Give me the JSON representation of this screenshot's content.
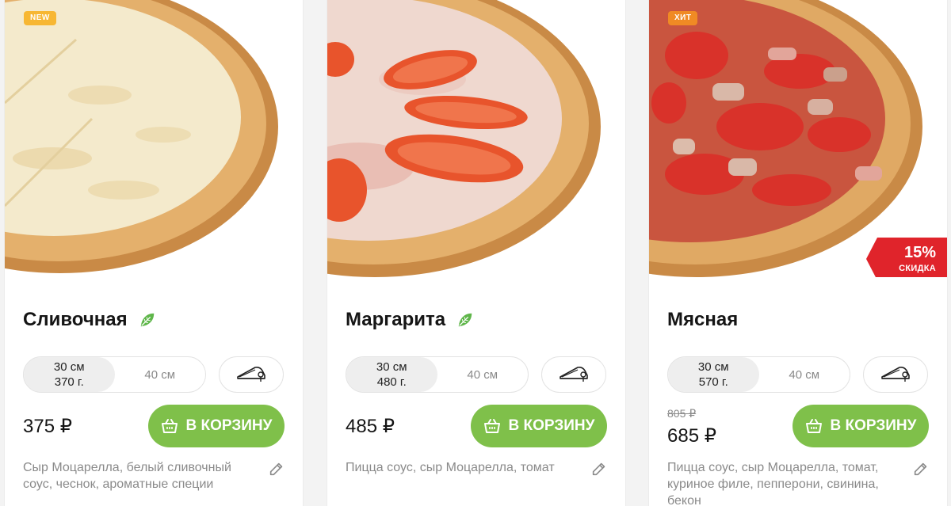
{
  "colors": {
    "accent_green": "#7fc04a",
    "discount_red": "#e0242b",
    "badge_new": "#f7b733",
    "badge_hit": "#f08a24",
    "text_dark": "#151515",
    "text_muted": "#8a8a8a"
  },
  "products": [
    {
      "badge": "NEW",
      "name": "Сливочная",
      "vegetarian_icon": "leaf-icon",
      "sizes": [
        {
          "size": "30 см",
          "weight": "370 г.",
          "selected": true
        },
        {
          "size": "40 см",
          "weight": "",
          "selected": false
        }
      ],
      "crust_icon": "crust-icon",
      "price": "375 ₽",
      "cart_label": "В КОРЗИНУ",
      "description": "Сыр Моцарелла, белый сливочный соус, чеснок, ароматные специи"
    },
    {
      "name": "Маргарита",
      "vegetarian_icon": "leaf-icon",
      "sizes": [
        {
          "size": "30 см",
          "weight": "480 г.",
          "selected": true
        },
        {
          "size": "40 см",
          "weight": "",
          "selected": false
        }
      ],
      "crust_icon": "crust-icon",
      "price": "485 ₽",
      "cart_label": "В КОРЗИНУ",
      "description": "Пицца соус, сыр Моцарелла, томат"
    },
    {
      "badge": "ХИТ",
      "name": "Мясная",
      "discount": {
        "percent": "15%",
        "label": "СКИДКА"
      },
      "sizes": [
        {
          "size": "30 см",
          "weight": "570 г.",
          "selected": true
        },
        {
          "size": "40 см",
          "weight": "",
          "selected": false
        }
      ],
      "crust_icon": "crust-icon",
      "old_price": "805 ₽",
      "price": "685 ₽",
      "cart_label": "В КОРЗИНУ",
      "description": "Пицца соус, сыр Моцарелла, томат, куриное филе, пепперони, свинина, бекон"
    }
  ]
}
